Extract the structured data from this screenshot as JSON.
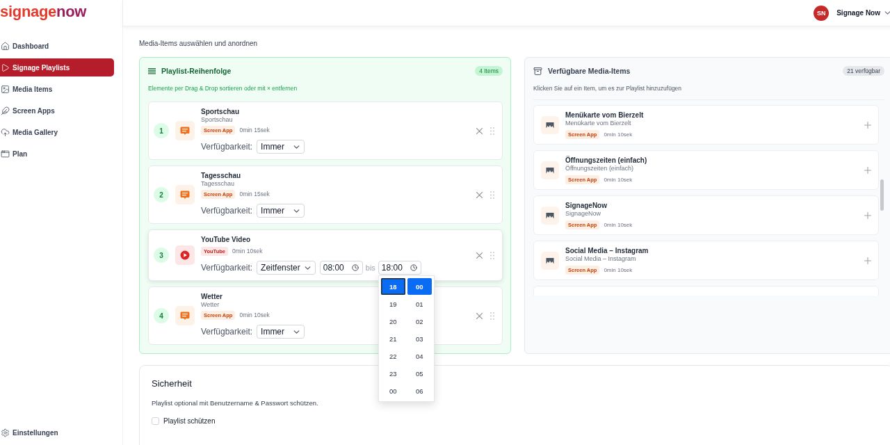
{
  "logo": {
    "prefix": "signage",
    "suffix": "now"
  },
  "sidebar": {
    "items": [
      {
        "label": "Dashboard",
        "selected": false
      },
      {
        "label": "Signage Playlists",
        "selected": true
      },
      {
        "label": "Media Items",
        "selected": false
      },
      {
        "label": "Screen Apps",
        "selected": false
      },
      {
        "label": "Media Gallery",
        "selected": false
      },
      {
        "label": "Plan",
        "selected": false
      }
    ],
    "footer_item": {
      "label": "Einstellungen"
    }
  },
  "top_bar": {
    "user": {
      "initials": "SN",
      "name": "Signage Now"
    }
  },
  "section_label": "Media-Items auswählen und anordnen",
  "playlist": {
    "title": "Playlist-Reihenfolge",
    "count": "4 Items",
    "hint": "Elemente per Drag & Drop sortieren oder mit × entfernen",
    "items": [
      {
        "number": "1",
        "title": "Sportschau",
        "subtitle": "Sportschau",
        "kind": "screen_app",
        "tag": "Screen App",
        "duration": "0min 15sek",
        "availability_label": "Verfügbarkeit:",
        "availability": "Immer"
      },
      {
        "number": "2",
        "title": "Tagesschau",
        "subtitle": "Tagesschau",
        "kind": "screen_app",
        "tag": "Screen App",
        "duration": "0min 15sek",
        "availability_label": "Verfügbarkeit:",
        "availability": "Immer"
      },
      {
        "number": "3",
        "title": "YouTube Video",
        "kind": "youtube",
        "tag": "YouTube",
        "duration": "0min 10sek",
        "availability_label": "Verfügbarkeit:",
        "availability": "Zeitfenster",
        "time_window": {
          "from": "08:00",
          "separator": "bis",
          "to": "18:00",
          "picker": {
            "open": true,
            "hours": [
              {
                "label": "18",
                "selected": true,
                "focused": true
              },
              {
                "label": "19",
                "selected": false,
                "focused": false
              },
              {
                "label": "20",
                "selected": false,
                "focused": false
              },
              {
                "label": "21",
                "selected": false,
                "focused": false
              },
              {
                "label": "22",
                "selected": false,
                "focused": false
              },
              {
                "label": "23",
                "selected": false,
                "focused": false
              },
              {
                "label": "00",
                "selected": false,
                "focused": false
              }
            ],
            "minutes": [
              {
                "label": "00",
                "selected": true
              },
              {
                "label": "01",
                "selected": false
              },
              {
                "label": "02",
                "selected": false
              },
              {
                "label": "03",
                "selected": false
              },
              {
                "label": "04",
                "selected": false
              },
              {
                "label": "05",
                "selected": false
              },
              {
                "label": "06",
                "selected": false
              }
            ]
          }
        }
      },
      {
        "number": "4",
        "title": "Wetter",
        "subtitle": "Wetter",
        "kind": "screen_app",
        "tag": "Screen App",
        "duration": "0min 10sek",
        "availability_label": "Verfügbarkeit:",
        "availability": "Immer"
      }
    ]
  },
  "library": {
    "title": "Verfügbare Media-Items",
    "count": "21 verfügbar",
    "hint": "Klicken Sie auf ein Item, um es zur Playlist hinzuzufügen",
    "items": [
      {
        "title": "Menükarte vom Bierzelt",
        "subtitle": "Menükarte vom Bierzelt",
        "tag": "Screen App",
        "duration": "0min 10sek"
      },
      {
        "title": "Öffnungszeiten (einfach)",
        "subtitle": "Öffnungszeiten (einfach)",
        "tag": "Screen App",
        "duration": "0min 10sek"
      },
      {
        "title": "SignageNow",
        "subtitle": "SignageNow",
        "tag": "Screen App",
        "duration": "0min 10sek"
      },
      {
        "title": "Social Media – Instagram",
        "subtitle": "Social Media – Instagram",
        "tag": "Screen App",
        "duration": "0min 10sek"
      }
    ],
    "more_below": true
  },
  "security": {
    "title": "Sicherheit",
    "description": "Playlist optional mit Benutzername & Passwort schützen.",
    "checkbox": {
      "label": "Playlist schützen",
      "checked": false
    }
  }
}
